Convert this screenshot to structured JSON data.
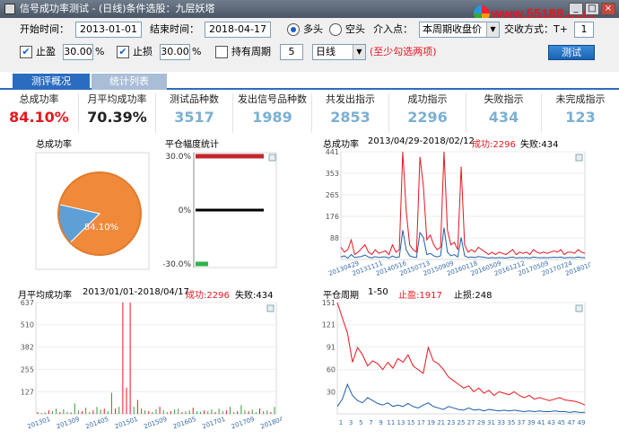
{
  "window": {
    "title": "信号成功率测试 - (日线)条件选股：九层妖塔",
    "min": "_",
    "max": "□",
    "close": "×"
  },
  "watermark": "www.55188.com",
  "toolbar": {
    "start_label": "开始时间：",
    "start_value": "2013-01-01",
    "end_label": "结束时间：",
    "end_value": "2018-04-17",
    "long_label": "多头",
    "short_label": "空头",
    "entry_label": "介入点：",
    "entry_value": "本周期收盘价",
    "trade_label": "交收方式：T+",
    "trade_value": "1",
    "tp_label": "止盈",
    "tp_value": "30.00",
    "tp_unit": "%",
    "sl_label": "止损",
    "sl_value": "30.00",
    "sl_unit": "%",
    "hold_label": "持有周期",
    "hold_value": "5",
    "period_value": "日线",
    "hint": "(至少勾选两项)",
    "test_button": "测试"
  },
  "tabs": [
    "测评概况",
    "统计列表"
  ],
  "stats": [
    {
      "label": "总成功率",
      "value": "84.10%",
      "color": "#e8161f"
    },
    {
      "label": "月平均成功率",
      "value": "70.39%",
      "color": "#222222"
    },
    {
      "label": "测试品种数",
      "value": "3517",
      "color": "#7ab0d4"
    },
    {
      "label": "发出信号品种数",
      "value": "1989",
      "color": "#7ab0d4"
    },
    {
      "label": "共发出指示",
      "value": "2853",
      "color": "#7ab0d4"
    },
    {
      "label": "成功指示",
      "value": "2296",
      "color": "#7ab0d4"
    },
    {
      "label": "失败指示",
      "value": "434",
      "color": "#7ab0d4"
    },
    {
      "label": "未完成指示",
      "value": "123",
      "color": "#7ab0d4"
    }
  ],
  "panels": {
    "pie_title": "总成功率",
    "range_title": "平仓幅度统计",
    "overall_title": "总成功率",
    "overall_range": "2013/04/29-2018/02/12",
    "success_label": "成功:2296",
    "fail_label": "失败:434",
    "monthly_title": "月平均成功率",
    "monthly_range": "2013/01/01-2018/04/17",
    "period_title": "平仓周期",
    "period_range": "1-50",
    "tp_count": "止盈:1917",
    "sl_count": "止损:248"
  },
  "chart_data": [
    {
      "type": "pie",
      "values": [
        84.1,
        15.9
      ],
      "labels": [
        "84.10%",
        ""
      ],
      "colors": [
        "#f08a3a",
        "#5e9fd6"
      ]
    },
    {
      "type": "bar",
      "categories": [
        "30.0%",
        "0%",
        "-30.0%"
      ],
      "values": [
        30,
        0,
        -30
      ],
      "ylim": [
        -30,
        30
      ],
      "colors": [
        "#c4262e",
        "#000000",
        "#2db34a"
      ]
    },
    {
      "type": "line",
      "yticks": [
        88,
        176,
        265,
        353,
        441
      ],
      "ylim": [
        0,
        441
      ],
      "xticks": [
        "20130429",
        "20131111",
        "20140516",
        "20150713",
        "20150909",
        "20160118",
        "20160509",
        "20161212",
        "20170509",
        "20170724",
        "20180108"
      ],
      "series": [
        {
          "color": "#e8161f",
          "values": [
            50,
            30,
            40,
            80,
            20,
            30,
            45,
            60,
            30,
            20,
            40,
            25,
            30,
            35,
            20,
            60,
            30,
            40,
            441,
            200,
            60,
            40,
            30,
            420,
            300,
            80,
            100,
            60,
            40,
            50,
            441,
            120,
            60,
            70,
            40,
            380,
            60,
            30,
            40,
            30,
            50,
            40,
            30,
            20,
            30,
            20,
            30,
            25,
            20,
            30,
            40,
            20,
            30,
            25,
            30,
            20,
            40,
            30,
            25,
            30,
            25,
            30,
            35,
            30,
            40,
            20,
            30,
            30,
            25,
            40,
            30,
            25
          ]
        },
        {
          "color": "#1f5fa8",
          "values": [
            10,
            15,
            5,
            20,
            8,
            10,
            12,
            18,
            10,
            6,
            12,
            8,
            10,
            10,
            6,
            14,
            8,
            10,
            120,
            40,
            15,
            10,
            8,
            110,
            90,
            20,
            25,
            15,
            10,
            15,
            130,
            30,
            15,
            20,
            10,
            90,
            15,
            8,
            10,
            8,
            12,
            10,
            8,
            6,
            8,
            6,
            8,
            7,
            6,
            8,
            10,
            6,
            8,
            7,
            8,
            6,
            10,
            8,
            7,
            8,
            7,
            8,
            9,
            8,
            10,
            6,
            8,
            8,
            7,
            10,
            8,
            7
          ]
        }
      ]
    },
    {
      "type": "bar",
      "yticks": [
        127,
        255,
        382,
        510,
        637
      ],
      "ylim": [
        0,
        637
      ],
      "xticks": [
        "201301",
        "201309",
        "201405",
        "201501",
        "201509",
        "201605",
        "201701",
        "201709",
        "201804"
      ],
      "values": [
        10,
        5,
        8,
        20,
        15,
        30,
        10,
        25,
        12,
        8,
        60,
        20,
        15,
        35,
        10,
        20,
        40,
        25,
        30,
        15,
        120,
        30,
        40,
        637,
        150,
        637,
        40,
        80,
        30,
        20,
        15,
        10,
        25,
        40,
        20,
        10,
        15,
        25,
        30,
        10,
        15,
        20,
        35,
        15,
        10,
        20,
        15,
        25,
        10,
        30,
        15,
        20,
        40,
        10,
        15,
        50,
        20,
        15,
        25,
        10,
        30,
        15,
        20,
        10,
        40
      ]
    },
    {
      "type": "line",
      "yticks": [
        30,
        60,
        91,
        121,
        151
      ],
      "ylim": [
        0,
        151
      ],
      "xticks": [
        "1",
        "3",
        "5",
        "7",
        "9",
        "11",
        "13",
        "15",
        "17",
        "19",
        "21",
        "23",
        "25",
        "27",
        "29",
        "31",
        "33",
        "35",
        "37",
        "39",
        "41",
        "43",
        "45",
        "47",
        "49"
      ],
      "series": [
        {
          "color": "#e8161f",
          "values": [
            151,
            130,
            110,
            70,
            90,
            80,
            65,
            72,
            68,
            60,
            70,
            62,
            75,
            70,
            80,
            65,
            60,
            55,
            90,
            72,
            68,
            60,
            50,
            45,
            40,
            35,
            38,
            30,
            35,
            28,
            32,
            25,
            30,
            28,
            26,
            30,
            25,
            22,
            25,
            20,
            22,
            20,
            18,
            20,
            22,
            19,
            18,
            17,
            15,
            12
          ]
        },
        {
          "color": "#1f5fa8",
          "values": [
            10,
            20,
            40,
            25,
            18,
            15,
            22,
            18,
            14,
            12,
            15,
            10,
            12,
            10,
            14,
            10,
            8,
            12,
            15,
            10,
            8,
            6,
            10,
            8,
            6,
            5,
            8,
            5,
            6,
            4,
            6,
            5,
            4,
            5,
            4,
            5,
            4,
            3,
            4,
            3,
            4,
            3,
            3,
            4,
            3,
            3,
            2,
            3,
            2,
            2
          ]
        }
      ]
    }
  ]
}
